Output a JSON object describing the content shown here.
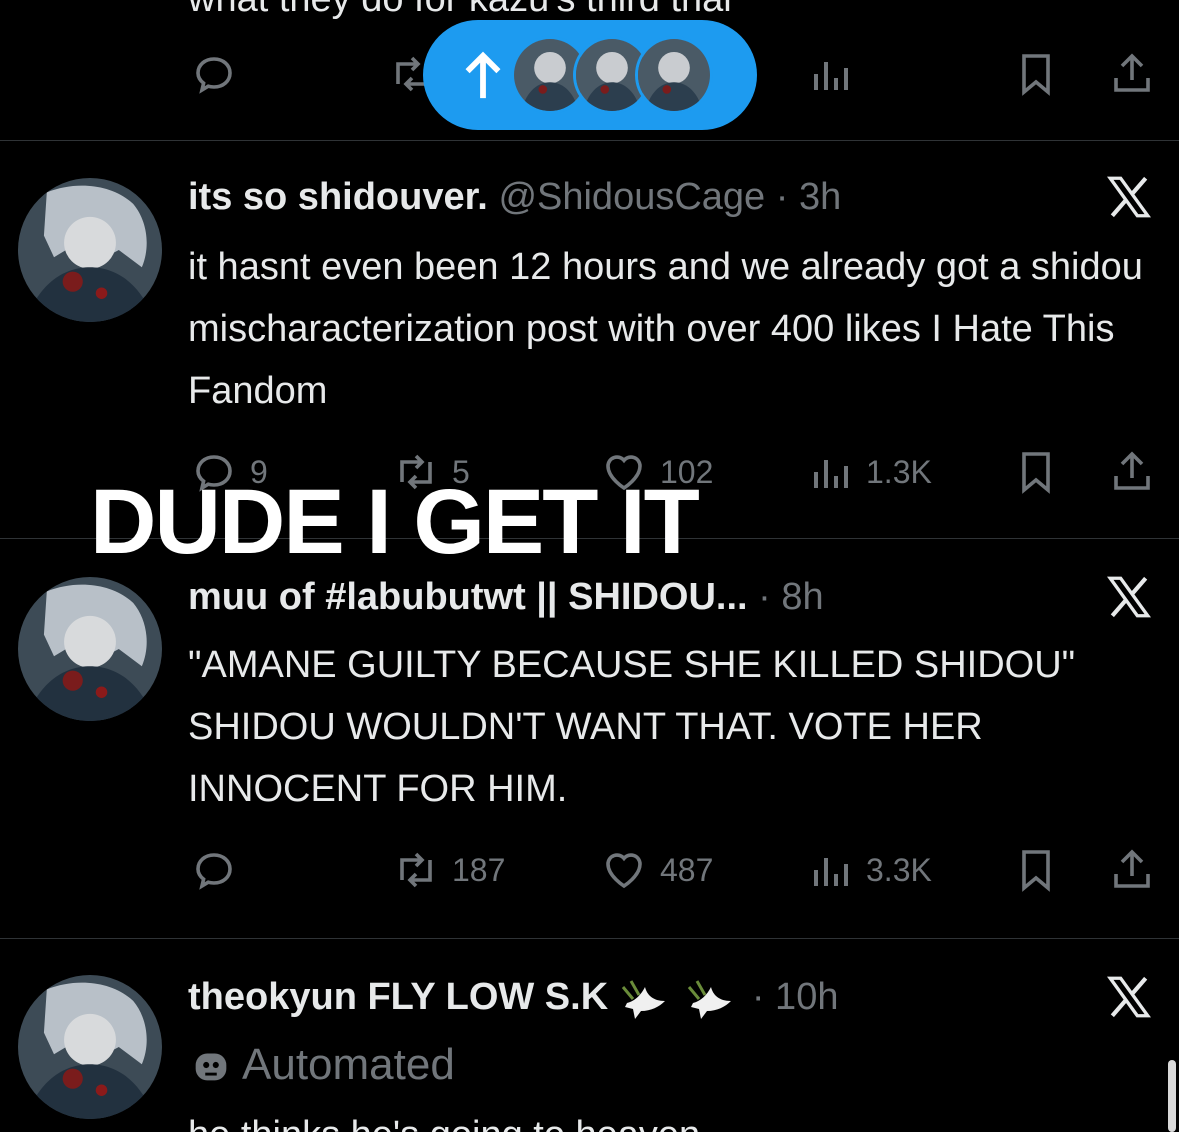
{
  "top_cut_text": "what they do for kazu's third trial",
  "new_posts_pill": {
    "arrow_icon": "arrow-up-icon",
    "avatars": 3
  },
  "overlay_caption": "DUDE I GET IT",
  "tweets": [
    {
      "name": "its so shidouver.",
      "handle": "@ShidousCage",
      "time": "· 3h",
      "text": "it hasnt even been 12 hours and we already got a shidou mischaracterization post with over 400 likes I Hate This Fandom",
      "replies": "9",
      "retweets": "5",
      "likes": "102",
      "views": "1.3K"
    },
    {
      "name": "muu of #labubutwt || SHIDOU...",
      "handle": "",
      "time": "· 8h",
      "text": "\"AMANE GUILTY BECAUSE SHE KILLED SHIDOU\" SHIDOU WOULDN'T WANT THAT. VOTE HER INNOCENT FOR HIM.",
      "replies": "",
      "retweets": "187",
      "likes": "487",
      "views": "3.3K"
    },
    {
      "name": "theokyun FLY LOW S.K",
      "handle": "",
      "time": "· 10h",
      "automated_label": "Automated",
      "text": "he thinks he's going to heaven"
    }
  ],
  "colors": {
    "background": "#000000",
    "text": "#e7e9ea",
    "muted": "#71767b",
    "accent": "#1d9bf0",
    "divider": "#2f3336"
  }
}
